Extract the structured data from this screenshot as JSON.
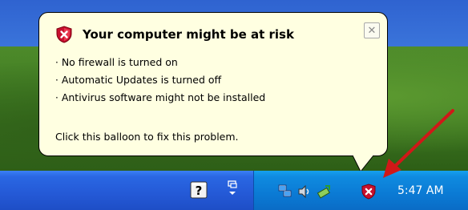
{
  "balloon": {
    "title": "Your computer might be at risk",
    "close_glyph": "✕",
    "bullets": [
      "No firewall is turned on",
      "Automatic Updates is turned off",
      "Antivirus software might not be installed"
    ],
    "bullet_glyph": "·",
    "fix_text": "Click this balloon to fix this problem.",
    "title_icon": "security-shield-icon"
  },
  "taskbar": {
    "clock": "5:47 AM",
    "tray_icons": [
      "network-icon",
      "volume-icon",
      "safely-remove-hardware-icon",
      "security-center-shield-icon"
    ],
    "help_icon": "help-icon",
    "hidden_icons": "chevron-expand-icon"
  },
  "annotation": {
    "arrow_color": "#d01818"
  }
}
